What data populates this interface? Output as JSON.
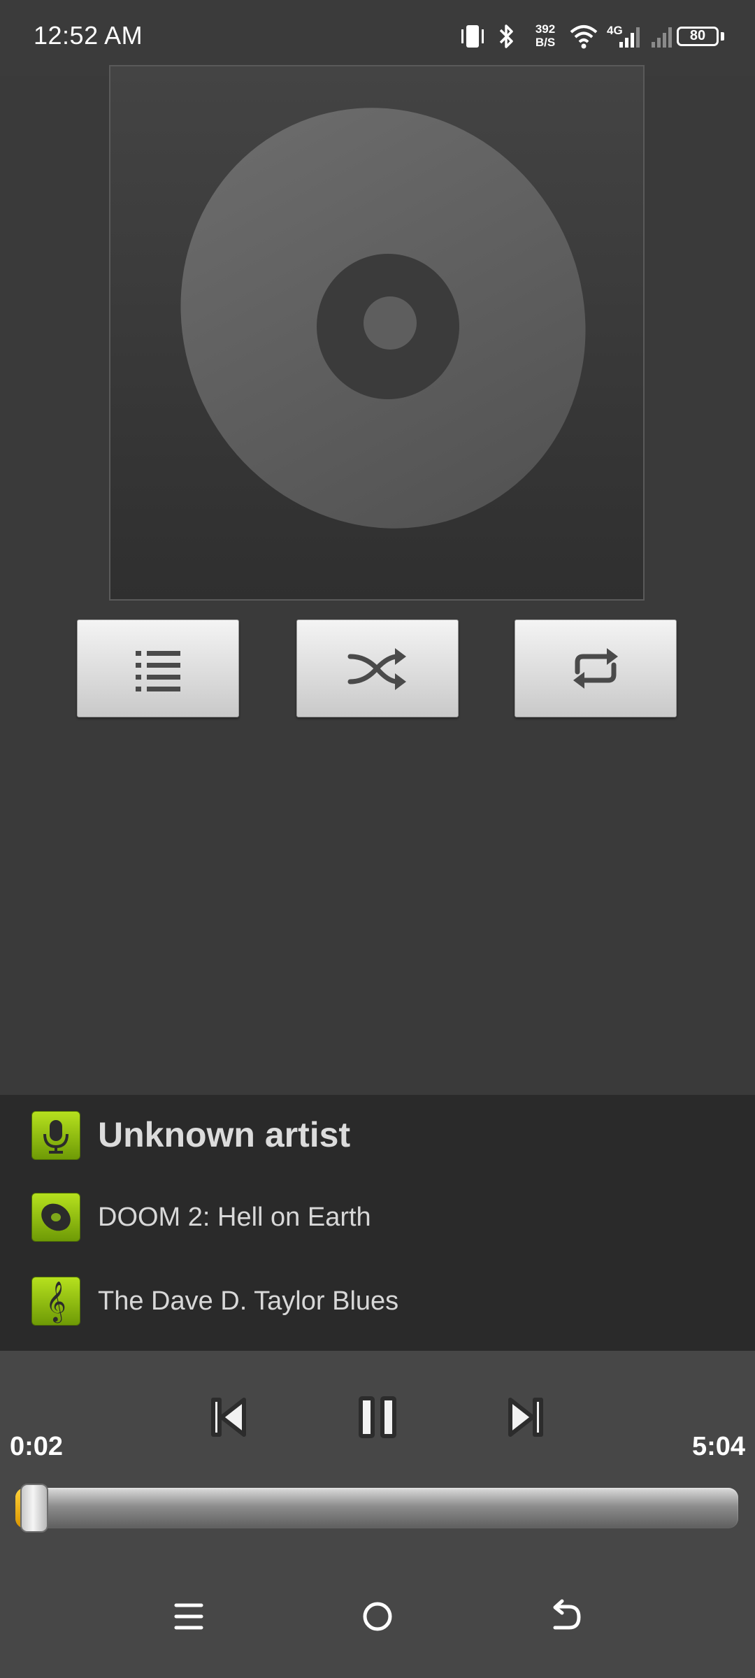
{
  "status_bar": {
    "time": "12:52 AM",
    "net_speed_value": "392",
    "net_speed_unit": "B/S",
    "network_type": "4G",
    "battery": "80",
    "icons": [
      "vibrate-icon",
      "bluetooth-icon",
      "wifi-icon",
      "signal-icon",
      "signal-weak-icon",
      "battery-icon"
    ]
  },
  "album_art": {
    "icon": "disc-icon"
  },
  "mode_buttons": [
    {
      "name": "playlist-button",
      "icon": "playlist-icon"
    },
    {
      "name": "shuffle-button",
      "icon": "shuffle-icon"
    },
    {
      "name": "repeat-button",
      "icon": "repeat-icon"
    }
  ],
  "track_info": {
    "artist": "Unknown artist",
    "album": "DOOM 2: Hell on Earth",
    "title": "The Dave D. Taylor Blues",
    "icons": [
      "microphone-icon",
      "album-disc-icon",
      "treble-clef-icon"
    ]
  },
  "playback": {
    "current_time": "0:02",
    "total_time": "5:04",
    "progress_fraction": 0.0066,
    "state": "playing",
    "controls": [
      "previous-icon",
      "pause-icon",
      "next-icon"
    ]
  },
  "nav_bar": {
    "icons": [
      "menu-icon",
      "home-icon",
      "back-icon"
    ]
  },
  "colors": {
    "background": "#3a3a3a",
    "panel": "#2a2a2a",
    "controls": "#474747",
    "accent_green": "#8cc20e",
    "accent_yellow": "#f2b400"
  }
}
